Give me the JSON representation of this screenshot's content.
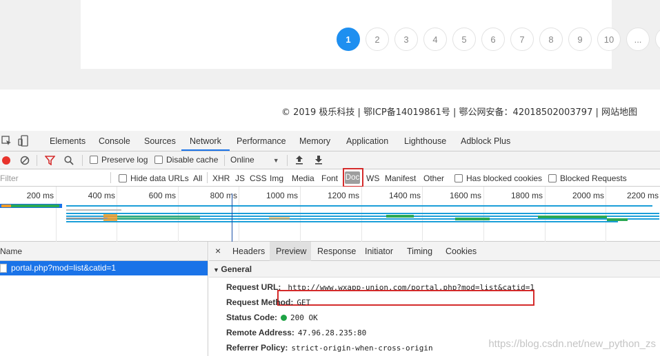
{
  "pagination": {
    "pages": [
      "1",
      "2",
      "3",
      "4",
      "5",
      "6",
      "7",
      "8",
      "9",
      "10",
      "...",
      ">>"
    ],
    "active": "1"
  },
  "footer": {
    "text": "© 2019 极乐科技 | 鄂ICP备14019861号 | 鄂公网安备：42018502003797 | 网站地图"
  },
  "devtools": {
    "tabs": [
      "Elements",
      "Console",
      "Sources",
      "Network",
      "Performance",
      "Memory",
      "Application",
      "Lighthouse",
      "Adblock Plus"
    ],
    "active_tab": "Network",
    "toolbar": {
      "preserve_log": "Preserve log",
      "disable_cache": "Disable cache",
      "throttle": "Online"
    },
    "filter": {
      "placeholder": "Filter",
      "hide_data_urls": "Hide data URLs",
      "types": [
        "All",
        "XHR",
        "JS",
        "CSS",
        "Img",
        "Media",
        "Font",
        "Doc",
        "WS",
        "Manifest",
        "Other"
      ],
      "selected_type": "Doc",
      "has_blocked_cookies": "Has blocked cookies",
      "blocked_requests": "Blocked Requests"
    },
    "timeline_ticks": [
      "200 ms",
      "400 ms",
      "600 ms",
      "800 ms",
      "1000 ms",
      "1200 ms",
      "1400 ms",
      "1600 ms",
      "1800 ms",
      "2000 ms",
      "2200 ms"
    ],
    "request_list": {
      "name_header": "Name",
      "selected_request": "portal.php?mod=list&catid=1"
    },
    "detail": {
      "close_glyph": "×",
      "tabs": [
        "Headers",
        "Preview",
        "Response",
        "Initiator",
        "Timing",
        "Cookies"
      ],
      "section": "General",
      "rows": [
        {
          "key": "Request URL:",
          "value": "http://www.wxapp-union.com/portal.php?mod=list&catid=1"
        },
        {
          "key": "Request Method:",
          "value": "GET"
        },
        {
          "key": "Status Code:",
          "value": "200 OK"
        },
        {
          "key": "Remote Address:",
          "value": "47.96.28.235:80"
        },
        {
          "key": "Referrer Policy:",
          "value": "strict-origin-when-cross-origin"
        }
      ]
    }
  },
  "watermark": "https://blog.csdn.net/new_python_zs",
  "colors": {
    "accent": "#1a73e8",
    "highlight": "#d42a2a",
    "pager_active": "#1e8ff0",
    "status_ok": "#1ea345"
  }
}
